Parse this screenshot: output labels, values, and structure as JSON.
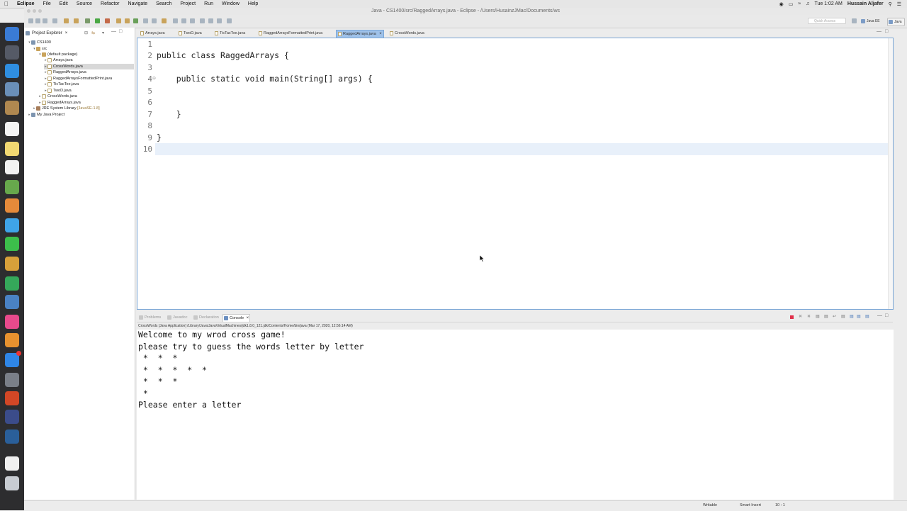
{
  "menubar": {
    "app": "Eclipse",
    "items": [
      "File",
      "Edit",
      "Source",
      "Refactor",
      "Navigate",
      "Search",
      "Project",
      "Run",
      "Window",
      "Help"
    ],
    "clock": "Tue 1:02 AM",
    "user": "Hussain Aljafer",
    "search_icon": "spotlight-search-icon"
  },
  "window": {
    "title": "Java - CS1400/src/RaggedArrays.java - Eclipse - /Users/HusainzJMac/Documents/ws"
  },
  "toolbar": {
    "quick_access_placeholder": "Quick Access",
    "perspectives": [
      "Java EE",
      "Java"
    ]
  },
  "explorer": {
    "tab_label": "Project Explorer",
    "tree": [
      {
        "label": "CS1400",
        "icon": "project-icon"
      },
      {
        "label": "src",
        "icon": "package-folder-icon"
      },
      {
        "label": "(default package)",
        "icon": "package-icon"
      },
      {
        "label": "Arrays.java",
        "icon": "java-file-icon"
      },
      {
        "label": "CrossWords.java",
        "icon": "java-file-icon"
      },
      {
        "label": "RaggedArrays.java",
        "icon": "java-file-icon"
      },
      {
        "label": "RaggedArraysFormattedPrint.java",
        "icon": "java-file-icon"
      },
      {
        "label": "TicTacToe.java",
        "icon": "java-file-icon"
      },
      {
        "label": "TwoD.java",
        "icon": "java-file-icon"
      },
      {
        "label": "CrossWords.java",
        "icon": "java-file-icon"
      },
      {
        "label": "RaggedArrays.java",
        "icon": "java-file-icon"
      },
      {
        "label": "JRE System Library",
        "suffix": "[JavaSE-1.8]",
        "icon": "library-icon"
      },
      {
        "label": "My Java Project",
        "icon": "project-icon"
      }
    ]
  },
  "editor": {
    "tabs": [
      "Arrays.java",
      "TwoD.java",
      "TicTacToe.java",
      "RaggedArraysFormattedPrint.java",
      "RaggedArrays.java",
      "CrossWords.java"
    ],
    "active_tab": "RaggedArrays.java",
    "line_numbers": [
      "1",
      "2",
      "3",
      "4",
      "5",
      "6",
      "7",
      "8",
      "9",
      "10"
    ],
    "lines": [
      "",
      "public class RaggedArrays {",
      "",
      "    public static void main(String[] args) {",
      "",
      "",
      "    }",
      "",
      "}",
      ""
    ]
  },
  "console": {
    "tabs": [
      "Problems",
      "Javadoc",
      "Declaration",
      "Console"
    ],
    "active_tab": "Console",
    "description": "CrossWords [Java Application] /Library/Java/JavaVirtualMachines/jdk1.8.0_121.jdk/Contents/Home/bin/java (Mar 17, 2020, 12:56:14 AM)",
    "output": [
      "Welcome to my wrod cross game!",
      "please try to guess the words letter by letter",
      " *  *  *",
      " *  *  *  *  *",
      " *  *  *",
      " *",
      "Please enter a letter"
    ]
  },
  "statusbar": {
    "writable": "Writable",
    "insert_mode": "Smart Insert",
    "position": "10 : 1"
  },
  "colors": {
    "active_tab": "#9fc2ea",
    "editor_border": "#7aa6d6",
    "current_line": "#e8f0fa",
    "dock": "#2d2d2f",
    "stop_button": "#e0304a"
  }
}
